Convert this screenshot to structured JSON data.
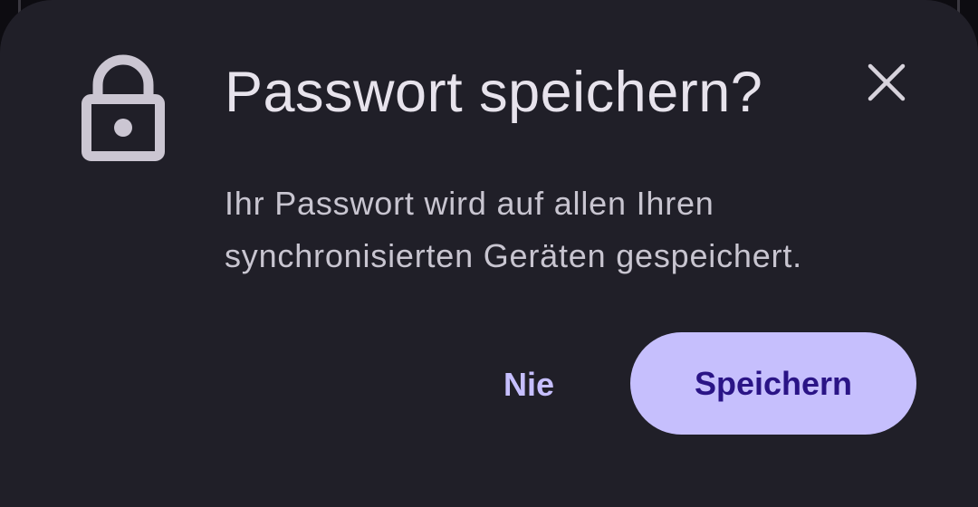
{
  "dialog": {
    "title": "Passwort speichern?",
    "message": "Ihr Passwort wird auf allen Ihren synchronisierten Geräten gespeichert.",
    "icon": "lock-icon",
    "close_icon": "close-icon"
  },
  "actions": {
    "never_label": "Nie",
    "save_label": "Speichern"
  },
  "colors": {
    "sheet_background": "#201f28",
    "title_text": "#e7e3ec",
    "body_text": "#c8c5d0",
    "icon": "#cbc6d2",
    "accent": "#c6bffd",
    "accent_text": "#2a1486",
    "text_button": "#c6bfff"
  }
}
